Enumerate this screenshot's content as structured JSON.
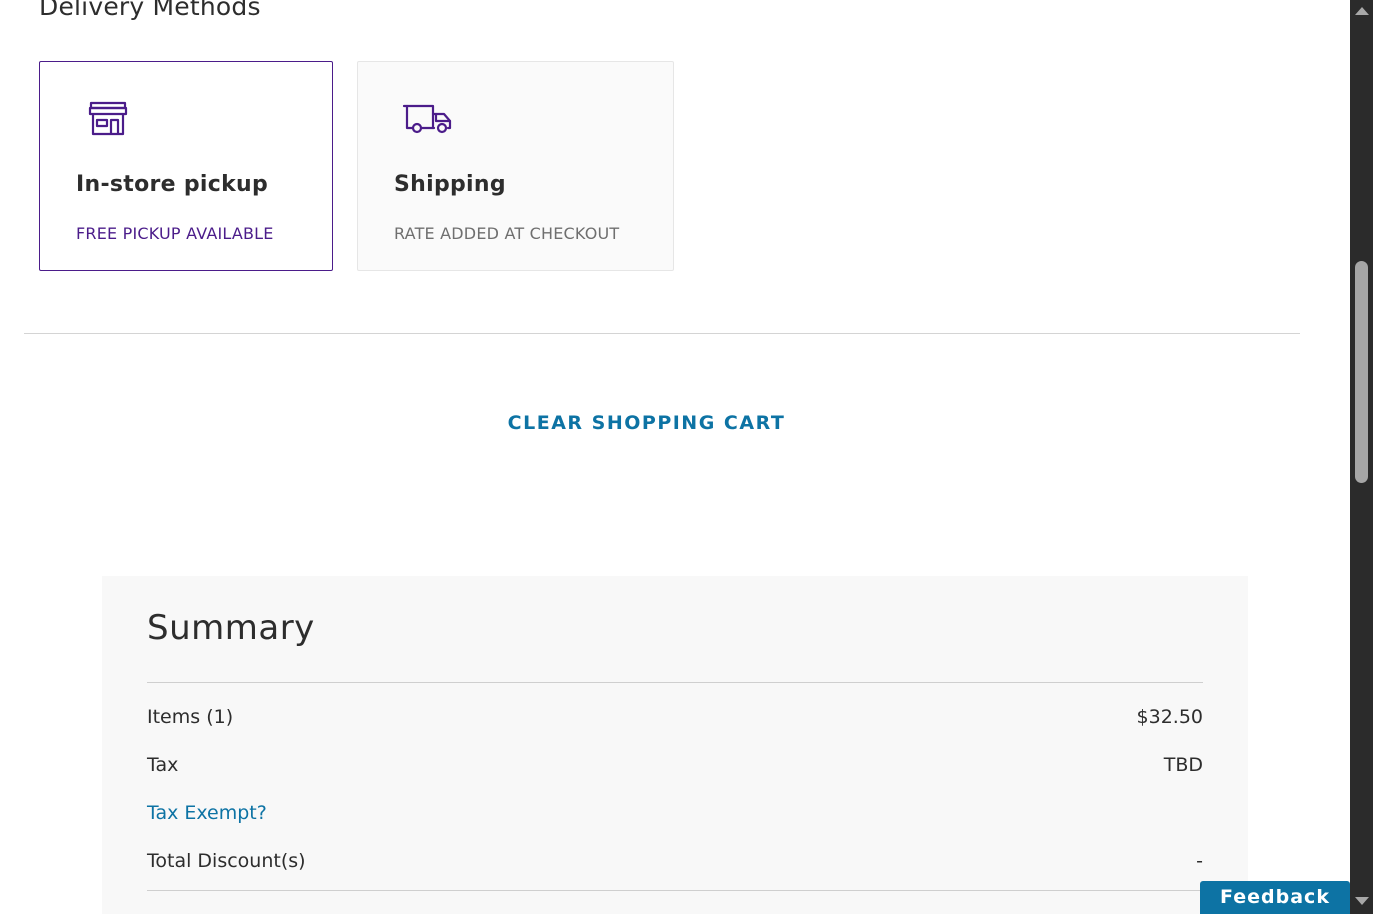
{
  "delivery": {
    "title": "Delivery Methods",
    "options": [
      {
        "name": "In-store pickup",
        "subtitle": "FREE PICKUP AVAILABLE",
        "icon": "store-icon",
        "selected": true
      },
      {
        "name": "Shipping",
        "subtitle": "RATE ADDED AT CHECKOUT",
        "icon": "truck-icon",
        "selected": false
      }
    ]
  },
  "cart": {
    "clear_label": "CLEAR SHOPPING CART"
  },
  "summary": {
    "title": "Summary",
    "items_label": "Items (1)",
    "items_value": "$32.50",
    "tax_label": "Tax",
    "tax_value": "TBD",
    "tax_exempt_link": "Tax Exempt?",
    "discount_label": "Total Discount(s)",
    "discount_value": "-"
  },
  "feedback": {
    "label": "Feedback"
  },
  "colors": {
    "accent_purple": "#4b1c8a",
    "link_blue": "#0d73a4",
    "text_dark": "#2d2d2d",
    "muted_gray": "#6f6f6f"
  }
}
